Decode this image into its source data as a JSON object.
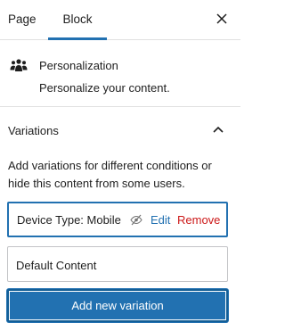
{
  "tabs": [
    {
      "label": "Page"
    },
    {
      "label": "Block"
    }
  ],
  "block": {
    "icon": "people-group-icon",
    "title": "Personalization",
    "description": "Personalize your content."
  },
  "panel": {
    "title": "Variations",
    "help": "Add variations for different conditions or hide this content from some users."
  },
  "variations": [
    {
      "label": "Device Type: Mobile",
      "edit": "Edit",
      "remove": "Remove"
    },
    {
      "label": "Default Content"
    }
  ],
  "add_button": "Add new variation",
  "colors": {
    "accent": "#2271b1",
    "danger": "#cc1818",
    "text": "#1e1e1e",
    "border": "#e0e0e0"
  }
}
